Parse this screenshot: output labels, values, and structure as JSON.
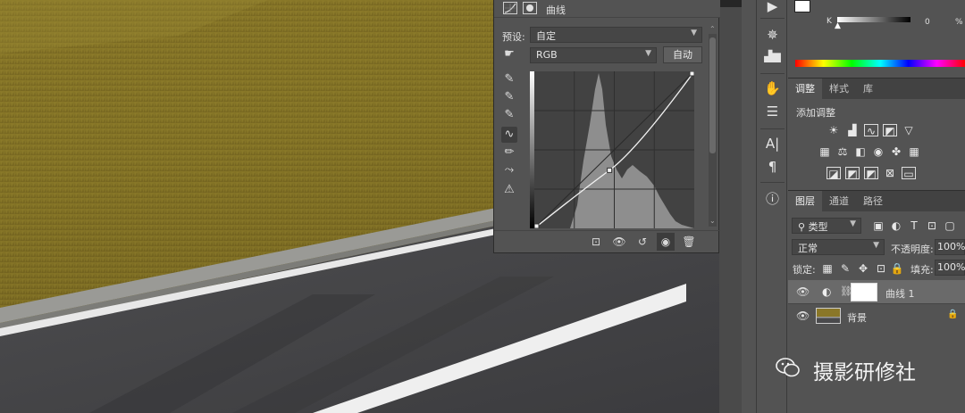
{
  "curves_panel": {
    "title": "曲线",
    "preset_label": "预设:",
    "preset_value": "自定",
    "channel_value": "RGB",
    "auto_button": "自动",
    "curve_points": [
      [
        0,
        0
      ],
      [
        0.47,
        0.37
      ],
      [
        1,
        1
      ]
    ]
  },
  "adjust_panel": {
    "tabs": [
      "调整",
      "样式",
      "库"
    ],
    "add_adjustment_label": "添加调整"
  },
  "color_panel": {
    "slider_channel": "K",
    "slider_value": "0",
    "slider_unit": "%"
  },
  "layers_panel": {
    "tabs": [
      "图层",
      "通道",
      "路径"
    ],
    "filter_kind": "类型",
    "blend_mode": "正常",
    "opacity_label": "不透明度:",
    "opacity_value": "100%",
    "lock_label": "锁定:",
    "fill_label": "填充:",
    "fill_value": "100%",
    "layers": [
      {
        "name": "曲线 1"
      },
      {
        "name": "背景"
      }
    ]
  },
  "watermark": {
    "text": "摄影研修社"
  }
}
